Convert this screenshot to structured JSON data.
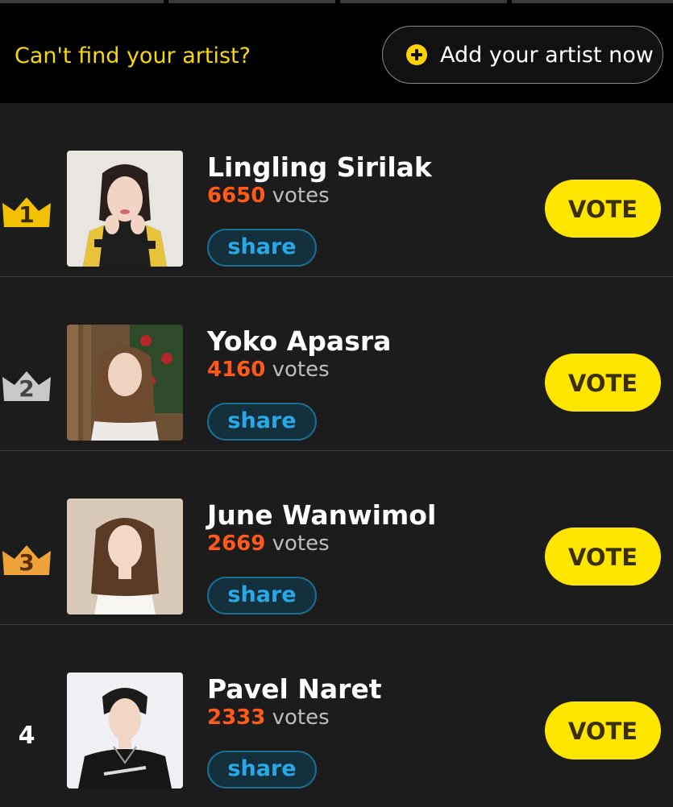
{
  "banner": {
    "prompt": "Can't find your artist?",
    "add_button_label": "Add your artist now"
  },
  "icons": {
    "add": "plus-circle-icon",
    "rank_1": "gold-crown-icon",
    "rank_2": "silver-crown-icon",
    "rank_3": "bronze-crown-icon"
  },
  "colors": {
    "accent_yellow": "#ffe600",
    "vote_count": "#ff5a1a",
    "share_blue": "#29a8e6",
    "crown_gold": "#f2c200",
    "crown_silver": "#c8c8c8",
    "crown_bronze": "#eea23a"
  },
  "artists": [
    {
      "rank": "1",
      "name": "Lingling Sirilak",
      "votes": "6650",
      "votes_word": "votes",
      "share_label": "share",
      "vote_label": "VOTE"
    },
    {
      "rank": "2",
      "name": "Yoko Apasra",
      "votes": "4160",
      "votes_word": "votes",
      "share_label": "share",
      "vote_label": "VOTE"
    },
    {
      "rank": "3",
      "name": "June Wanwimol",
      "votes": "2669",
      "votes_word": "votes",
      "share_label": "share",
      "vote_label": "VOTE"
    },
    {
      "rank": "4",
      "name": "Pavel Naret",
      "votes": "2333",
      "votes_word": "votes",
      "share_label": "share",
      "vote_label": "VOTE"
    }
  ]
}
